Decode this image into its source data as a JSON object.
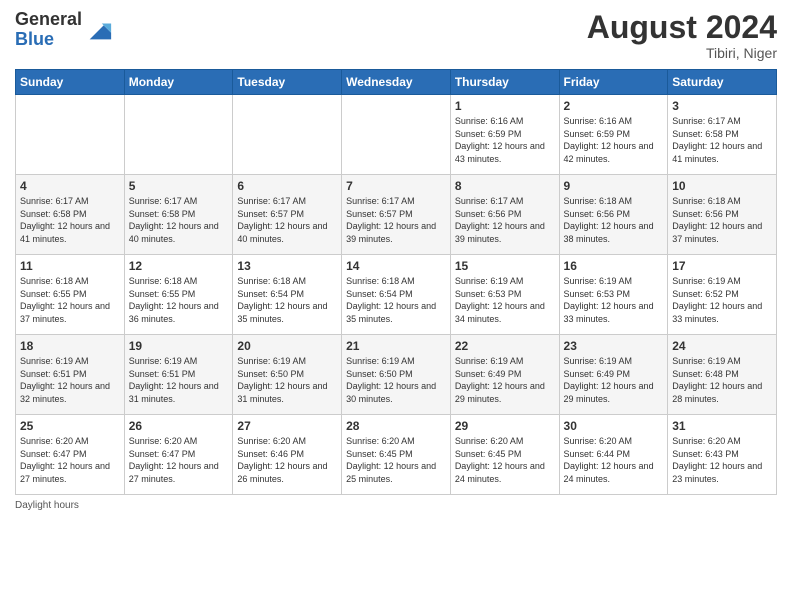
{
  "header": {
    "logo_general": "General",
    "logo_blue": "Blue",
    "month_year": "August 2024",
    "location": "Tibiri, Niger"
  },
  "days_of_week": [
    "Sunday",
    "Monday",
    "Tuesday",
    "Wednesday",
    "Thursday",
    "Friday",
    "Saturday"
  ],
  "weeks": [
    [
      {
        "day": "",
        "info": ""
      },
      {
        "day": "",
        "info": ""
      },
      {
        "day": "",
        "info": ""
      },
      {
        "day": "",
        "info": ""
      },
      {
        "day": "1",
        "info": "Sunrise: 6:16 AM\nSunset: 6:59 PM\nDaylight: 12 hours and 43 minutes."
      },
      {
        "day": "2",
        "info": "Sunrise: 6:16 AM\nSunset: 6:59 PM\nDaylight: 12 hours and 42 minutes."
      },
      {
        "day": "3",
        "info": "Sunrise: 6:17 AM\nSunset: 6:58 PM\nDaylight: 12 hours and 41 minutes."
      }
    ],
    [
      {
        "day": "4",
        "info": "Sunrise: 6:17 AM\nSunset: 6:58 PM\nDaylight: 12 hours and 41 minutes."
      },
      {
        "day": "5",
        "info": "Sunrise: 6:17 AM\nSunset: 6:58 PM\nDaylight: 12 hours and 40 minutes."
      },
      {
        "day": "6",
        "info": "Sunrise: 6:17 AM\nSunset: 6:57 PM\nDaylight: 12 hours and 40 minutes."
      },
      {
        "day": "7",
        "info": "Sunrise: 6:17 AM\nSunset: 6:57 PM\nDaylight: 12 hours and 39 minutes."
      },
      {
        "day": "8",
        "info": "Sunrise: 6:17 AM\nSunset: 6:56 PM\nDaylight: 12 hours and 39 minutes."
      },
      {
        "day": "9",
        "info": "Sunrise: 6:18 AM\nSunset: 6:56 PM\nDaylight: 12 hours and 38 minutes."
      },
      {
        "day": "10",
        "info": "Sunrise: 6:18 AM\nSunset: 6:56 PM\nDaylight: 12 hours and 37 minutes."
      }
    ],
    [
      {
        "day": "11",
        "info": "Sunrise: 6:18 AM\nSunset: 6:55 PM\nDaylight: 12 hours and 37 minutes."
      },
      {
        "day": "12",
        "info": "Sunrise: 6:18 AM\nSunset: 6:55 PM\nDaylight: 12 hours and 36 minutes."
      },
      {
        "day": "13",
        "info": "Sunrise: 6:18 AM\nSunset: 6:54 PM\nDaylight: 12 hours and 35 minutes."
      },
      {
        "day": "14",
        "info": "Sunrise: 6:18 AM\nSunset: 6:54 PM\nDaylight: 12 hours and 35 minutes."
      },
      {
        "day": "15",
        "info": "Sunrise: 6:19 AM\nSunset: 6:53 PM\nDaylight: 12 hours and 34 minutes."
      },
      {
        "day": "16",
        "info": "Sunrise: 6:19 AM\nSunset: 6:53 PM\nDaylight: 12 hours and 33 minutes."
      },
      {
        "day": "17",
        "info": "Sunrise: 6:19 AM\nSunset: 6:52 PM\nDaylight: 12 hours and 33 minutes."
      }
    ],
    [
      {
        "day": "18",
        "info": "Sunrise: 6:19 AM\nSunset: 6:51 PM\nDaylight: 12 hours and 32 minutes."
      },
      {
        "day": "19",
        "info": "Sunrise: 6:19 AM\nSunset: 6:51 PM\nDaylight: 12 hours and 31 minutes."
      },
      {
        "day": "20",
        "info": "Sunrise: 6:19 AM\nSunset: 6:50 PM\nDaylight: 12 hours and 31 minutes."
      },
      {
        "day": "21",
        "info": "Sunrise: 6:19 AM\nSunset: 6:50 PM\nDaylight: 12 hours and 30 minutes."
      },
      {
        "day": "22",
        "info": "Sunrise: 6:19 AM\nSunset: 6:49 PM\nDaylight: 12 hours and 29 minutes."
      },
      {
        "day": "23",
        "info": "Sunrise: 6:19 AM\nSunset: 6:49 PM\nDaylight: 12 hours and 29 minutes."
      },
      {
        "day": "24",
        "info": "Sunrise: 6:19 AM\nSunset: 6:48 PM\nDaylight: 12 hours and 28 minutes."
      }
    ],
    [
      {
        "day": "25",
        "info": "Sunrise: 6:20 AM\nSunset: 6:47 PM\nDaylight: 12 hours and 27 minutes."
      },
      {
        "day": "26",
        "info": "Sunrise: 6:20 AM\nSunset: 6:47 PM\nDaylight: 12 hours and 27 minutes."
      },
      {
        "day": "27",
        "info": "Sunrise: 6:20 AM\nSunset: 6:46 PM\nDaylight: 12 hours and 26 minutes."
      },
      {
        "day": "28",
        "info": "Sunrise: 6:20 AM\nSunset: 6:45 PM\nDaylight: 12 hours and 25 minutes."
      },
      {
        "day": "29",
        "info": "Sunrise: 6:20 AM\nSunset: 6:45 PM\nDaylight: 12 hours and 24 minutes."
      },
      {
        "day": "30",
        "info": "Sunrise: 6:20 AM\nSunset: 6:44 PM\nDaylight: 12 hours and 24 minutes."
      },
      {
        "day": "31",
        "info": "Sunrise: 6:20 AM\nSunset: 6:43 PM\nDaylight: 12 hours and 23 minutes."
      }
    ]
  ],
  "footer": {
    "daylight_hours": "Daylight hours"
  }
}
